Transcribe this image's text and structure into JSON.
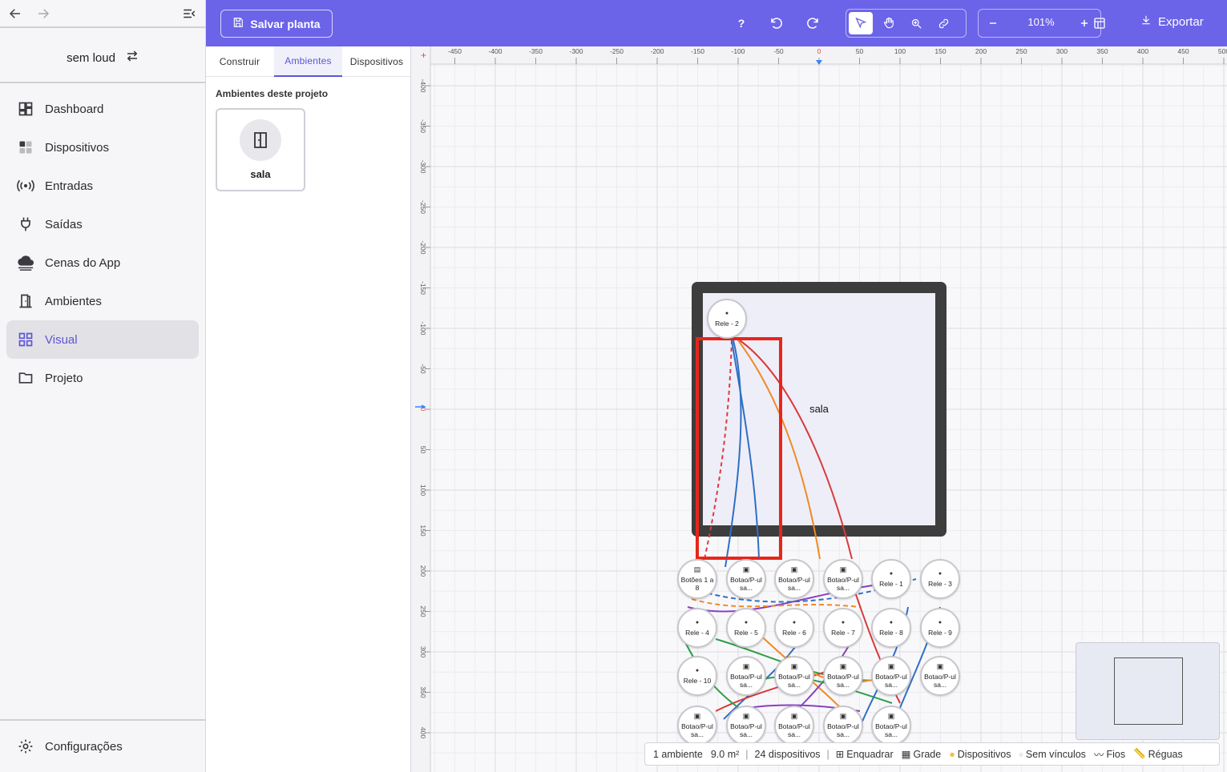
{
  "sidebar": {
    "project_name": "sem loud",
    "items": [
      {
        "label": "Dashboard",
        "icon": "dashboard-icon"
      },
      {
        "label": "Dispositivos",
        "icon": "devices-icon"
      },
      {
        "label": "Entradas",
        "icon": "broadcast-icon"
      },
      {
        "label": "Saídas",
        "icon": "plug-icon"
      },
      {
        "label": "Cenas do App",
        "icon": "cloud-icon"
      },
      {
        "label": "Ambientes",
        "icon": "door-icon"
      },
      {
        "label": "Visual",
        "icon": "grid-icon",
        "active": true
      },
      {
        "label": "Projeto",
        "icon": "folder-icon"
      }
    ],
    "settings_label": "Configurações"
  },
  "toolbar": {
    "save_label": "Salvar planta",
    "help_label": "?",
    "zoom_value": "101%",
    "export_label": "Exportar"
  },
  "panel": {
    "tabs": [
      "Construir",
      "Ambientes",
      "Dispositivos"
    ],
    "active_tab": "Ambientes",
    "title": "Ambientes deste projeto",
    "rooms": [
      {
        "name": "sala"
      }
    ]
  },
  "canvas": {
    "ruler_x_labels": [
      "-450",
      "-400",
      "-350",
      "-300",
      "-250",
      "-200",
      "-150",
      "-100",
      "-50",
      "0",
      "50",
      "100",
      "150",
      "200",
      "250",
      "300",
      "350",
      "400",
      "450",
      "500"
    ],
    "ruler_y_labels": [
      "-400",
      "-350",
      "-300",
      "-250",
      "-200",
      "-150",
      "-100",
      "-50",
      "0",
      "50",
      "100",
      "150",
      "200",
      "250",
      "300",
      "350",
      "400"
    ],
    "room_label": "sala",
    "devices": [
      {
        "label": "Rele - 2",
        "icon": "bulb"
      },
      {
        "label": "Botões 1 a 8",
        "icon": "keypad"
      },
      {
        "label": "Botao/P-ulsa...",
        "icon": "switch"
      },
      {
        "label": "Botao/P-ulsa...",
        "icon": "switch"
      },
      {
        "label": "Botao/P-ulsa...",
        "icon": "switch"
      },
      {
        "label": "Rele - 1",
        "icon": "bulb"
      },
      {
        "label": "Rele - 3",
        "icon": "bulb"
      },
      {
        "label": "Rele - 4",
        "icon": "bulb"
      },
      {
        "label": "Rele - 5",
        "icon": "bulb"
      },
      {
        "label": "Rele - 6",
        "icon": "bulb"
      },
      {
        "label": "Rele - 7",
        "icon": "bulb"
      },
      {
        "label": "Rele - 8",
        "icon": "bulb"
      },
      {
        "label": "Rele - 9",
        "icon": "bulb"
      },
      {
        "label": "Rele - 10",
        "icon": "bulb"
      },
      {
        "label": "Botao/P-ulsa...",
        "icon": "switch"
      },
      {
        "label": "Botao/P-ulsa...",
        "icon": "switch"
      },
      {
        "label": "Botao/P-ulsa...",
        "icon": "switch"
      },
      {
        "label": "Botao/P-ulsa...",
        "icon": "switch"
      },
      {
        "label": "Botao/P-ulsa...",
        "icon": "switch"
      },
      {
        "label": "Botao/P-ulsa...",
        "icon": "switch"
      },
      {
        "label": "Botao/P-ulsa...",
        "icon": "switch"
      },
      {
        "label": "Botao/P-ulsa...",
        "icon": "switch"
      },
      {
        "label": "Botao/P-ulsa...",
        "icon": "switch"
      },
      {
        "label": "Botao/P-ulsa...",
        "icon": "switch"
      }
    ]
  },
  "status": {
    "rooms_count": "1 ambiente",
    "area": "9.0 m²",
    "devices_count": "24 dispositivos",
    "fit_label": "Enquadrar",
    "grid_label": "Grade",
    "devices_label": "Dispositivos",
    "no_links_label": "Sem vínculos",
    "wires_label": "Fios",
    "rulers_label": "Réguas"
  },
  "colors": {
    "accent": "#6b63e8",
    "active_text": "#5b55d6",
    "wall": "#3d3d3d",
    "highlight": "#e8251b"
  }
}
